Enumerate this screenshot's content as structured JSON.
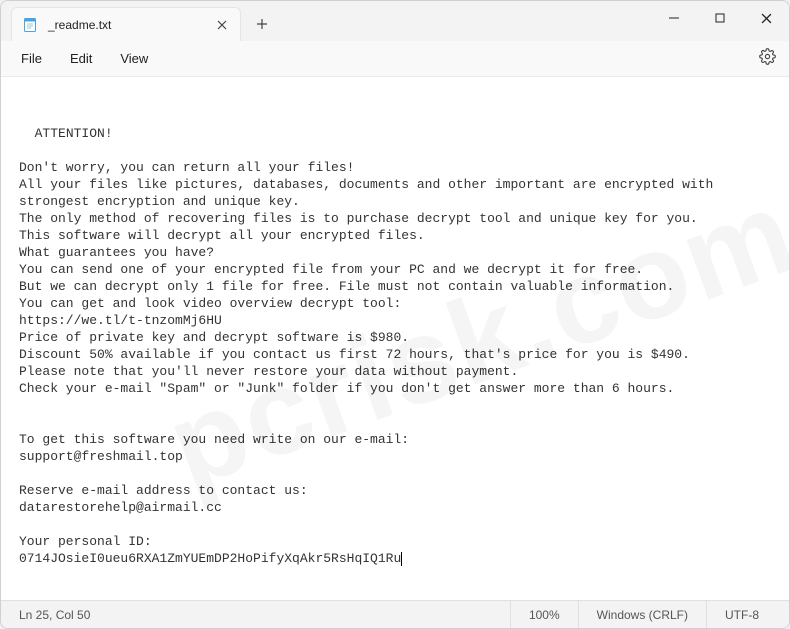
{
  "tab": {
    "title": "_readme.txt"
  },
  "menu": {
    "file": "File",
    "edit": "Edit",
    "view": "View"
  },
  "document": {
    "lines": [
      "ATTENTION!",
      "",
      "Don't worry, you can return all your files!",
      "All your files like pictures, databases, documents and other important are encrypted with strongest encryption and unique key.",
      "The only method of recovering files is to purchase decrypt tool and unique key for you.",
      "This software will decrypt all your encrypted files.",
      "What guarantees you have?",
      "You can send one of your encrypted file from your PC and we decrypt it for free.",
      "But we can decrypt only 1 file for free. File must not contain valuable information.",
      "You can get and look video overview decrypt tool:",
      "https://we.tl/t-tnzomMj6HU",
      "Price of private key and decrypt software is $980.",
      "Discount 50% available if you contact us first 72 hours, that's price for you is $490.",
      "Please note that you'll never restore your data without payment.",
      "Check your e-mail \"Spam\" or \"Junk\" folder if you don't get answer more than 6 hours.",
      "",
      "",
      "To get this software you need write on our e-mail:",
      "support@freshmail.top",
      "",
      "Reserve e-mail address to contact us:",
      "datarestorehelp@airmail.cc",
      "",
      "Your personal ID:",
      "0714JOsieI0ueu6RXA1ZmYUEmDP2HoPifyXqAkr5RsHqIQ1Ru"
    ]
  },
  "status": {
    "position": "Ln 25, Col 50",
    "zoom": "100%",
    "line_ending": "Windows (CRLF)",
    "encoding": "UTF-8"
  },
  "watermark": "pcrisk.com"
}
